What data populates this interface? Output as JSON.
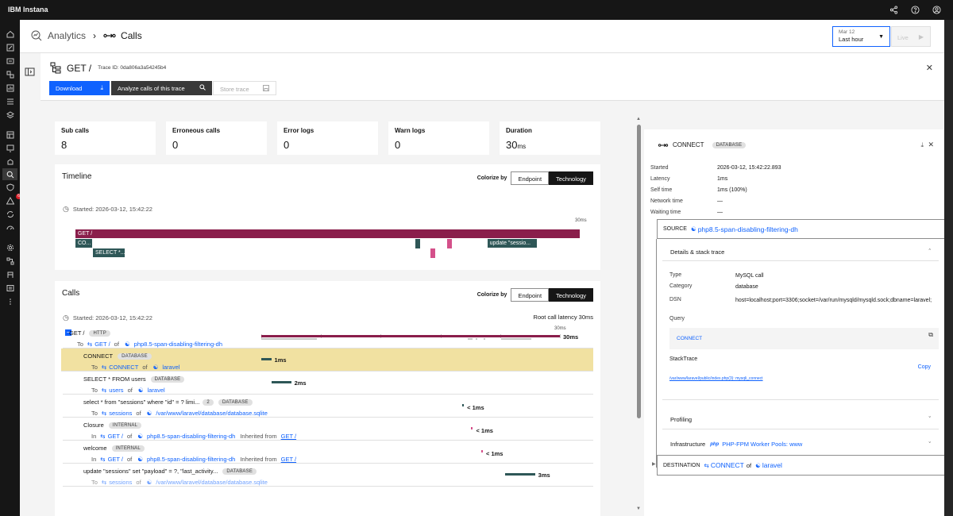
{
  "app": {
    "name": "IBM Instana"
  },
  "breadcrumb": {
    "root": "Analytics",
    "current": "Calls"
  },
  "timepicker": {
    "date": "Mar 12",
    "range": "Last hour",
    "live": "Live"
  },
  "trace": {
    "title": "GET /",
    "trace_id": "Trace ID: 0da806a3a54245b4"
  },
  "actions": {
    "download": "Download",
    "analyze": "Analyze calls of this trace",
    "store": "Store trace"
  },
  "stats": [
    {
      "label": "Sub calls",
      "value": "8",
      "unit": ""
    },
    {
      "label": "Erroneous calls",
      "value": "0",
      "unit": ""
    },
    {
      "label": "Error logs",
      "value": "0",
      "unit": ""
    },
    {
      "label": "Warn logs",
      "value": "0",
      "unit": ""
    },
    {
      "label": "Duration",
      "value": "30",
      "unit": "ms"
    }
  ],
  "timeline": {
    "title": "Timeline",
    "colorize_label": "Colorize by",
    "seg_endpoint": "Endpoint",
    "seg_tech": "Technology",
    "started": "Started: 2026-03-12, 15:42:22",
    "scale_end": "30ms",
    "bars": [
      {
        "label": "GET /",
        "start": 0,
        "dur": 30,
        "row": 0,
        "color": "#8a1e4b"
      },
      {
        "label": "CO...",
        "start": 0,
        "dur": 1,
        "row": 1,
        "color": "#2e5757"
      },
      {
        "label": "SELECT *...",
        "start": 1,
        "dur": 2,
        "row": 2,
        "color": "#2e5757"
      },
      {
        "label": "",
        "start": 20.2,
        "dur": 0.1,
        "row": 1,
        "color": "#2e5757"
      },
      {
        "label": "",
        "start": 21.1,
        "dur": 0.1,
        "row": 2,
        "color": "#d4508a"
      },
      {
        "label": "",
        "start": 22.1,
        "dur": 0.1,
        "row": 1,
        "color": "#d4508a"
      },
      {
        "label": "update \"sessio...",
        "start": 24.5,
        "dur": 3,
        "row": 1,
        "color": "#2e5757"
      }
    ]
  },
  "calls": {
    "title": "Calls",
    "colorize_label": "Colorize by",
    "seg_endpoint": "Endpoint",
    "seg_tech": "Technology",
    "started": "Started: 2026-03-12, 15:42:22",
    "root_latency": "Root call latency 30ms",
    "scale_end": "30ms",
    "rows": [
      {
        "name": "GET /",
        "tag": "HTTP",
        "count": "",
        "dir": "To",
        "endpoint": "GET /",
        "svc": "php8.5-span-disabling-filtering-dh",
        "inherited": "",
        "start": 0,
        "dur": 30,
        "latency": "30ms",
        "color": "#8a1e4b"
      },
      {
        "name": "CONNECT",
        "tag": "DATABASE",
        "count": "",
        "dir": "To",
        "endpoint": "CONNECT",
        "svc": "laravel",
        "inherited": "",
        "start": 0,
        "dur": 1,
        "latency": "1ms",
        "color": "#2e5757"
      },
      {
        "name": "SELECT * FROM users",
        "tag": "DATABASE",
        "count": "",
        "dir": "To",
        "endpoint": "users",
        "svc": "laravel",
        "inherited": "",
        "start": 1,
        "dur": 2,
        "latency": "2ms",
        "color": "#2e5757"
      },
      {
        "name": "select * from \"sessions\" where \"id\" = ? limi...",
        "tag": "DATABASE",
        "count": "2",
        "dir": "To",
        "endpoint": "sessions",
        "svc": "/var/www/laravel/database/database.sqlite",
        "inherited": "",
        "start": 20.2,
        "dur": 0.1,
        "latency": "< 1ms",
        "color": "#2e5757"
      },
      {
        "name": "Closure",
        "tag": "INTERNAL",
        "count": "",
        "dir": "In",
        "endpoint": "GET /",
        "svc": "php8.5-span-disabling-filtering-dh",
        "inherited": "GET /",
        "start": 21.1,
        "dur": 0.1,
        "latency": "< 1ms",
        "color": "#d4508a"
      },
      {
        "name": "welcome",
        "tag": "INTERNAL",
        "count": "",
        "dir": "In",
        "endpoint": "GET /",
        "svc": "php8.5-span-disabling-filtering-dh",
        "inherited": "GET /",
        "start": 22.1,
        "dur": 0.1,
        "latency": "< 1ms",
        "color": "#d4508a"
      },
      {
        "name": "update \"sessions\" set \"payload\" = ?, \"last_activity...",
        "tag": "DATABASE",
        "count": "",
        "dir": "To",
        "endpoint": "sessions",
        "svc": "/var/www/laravel/database/database.sqlite",
        "inherited": "",
        "start": 24.5,
        "dur": 3,
        "latency": "3ms",
        "color": "#2e5757"
      }
    ],
    "inherited_label": "Inherited from",
    "of_label": "of"
  },
  "detail": {
    "title": "CONNECT",
    "tag": "DATABASE",
    "fields": [
      {
        "k": "Started",
        "v": "2026-03-12, 15:42:22.893"
      },
      {
        "k": "Latency",
        "v": "1ms"
      },
      {
        "k": "Self time",
        "v": "1ms (100%)"
      },
      {
        "k": "Network time",
        "v": "—"
      },
      {
        "k": "Waiting time",
        "v": "—"
      }
    ],
    "source_label": "SOURCE",
    "source_value": "php8.5-span-disabling-filtering-dh",
    "details_label": "Details & stack trace",
    "type_k": "Type",
    "type_v": "MySQL call",
    "cat_k": "Category",
    "cat_v": "database",
    "dsn_k": "DSN",
    "dsn_v": "host=localhost;port=3306;socket=/var/run/mysqld/mysqld.sock;dbname=laravel;",
    "query_k": "Query",
    "query_v": "CONNECT",
    "stack_k": "StackTrace",
    "copy": "Copy",
    "stack_v": "/var/www/laravel/public/index.php(3): mysqli_connect",
    "profiling": "Profiling",
    "infra_k": "Infrastructure",
    "infra_v": "PHP-FPM Worker Pools: www",
    "dest_label": "DESTINATION",
    "dest_endpoint": "CONNECT",
    "dest_of": "of",
    "dest_svc": "laravel"
  }
}
